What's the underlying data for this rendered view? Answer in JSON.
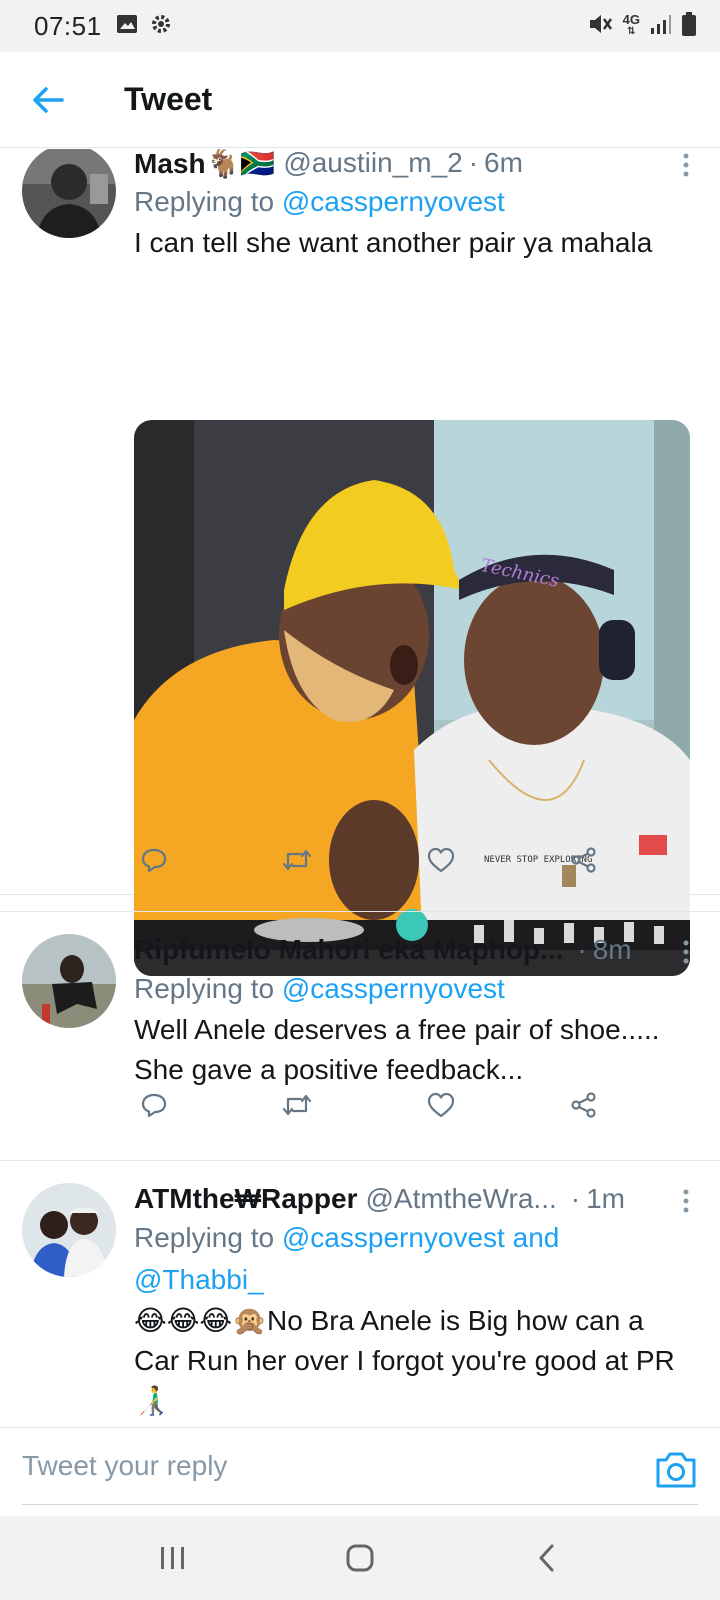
{
  "status_bar": {
    "time": "07:51",
    "left_icons": [
      "gallery-icon",
      "settings-icon"
    ],
    "right_icons": [
      "mute-icon",
      "network-4g-icon",
      "signal-icon",
      "battery-icon"
    ],
    "network_label": "4G"
  },
  "header": {
    "back_icon": "back-arrow-icon",
    "title": "Tweet"
  },
  "colors": {
    "accent": "#1da1f2",
    "text": "#14171a",
    "muted": "#657786",
    "divider": "#e1e8ed"
  },
  "tweets": [
    {
      "name": "Mash🐐🇿🇦",
      "handle": "@austiin_m_2",
      "time": "6m",
      "replying_prefix": "Replying to",
      "replying_to": "@casspernyovest",
      "text": "I can tell she want another pair ya mahala",
      "has_media": true,
      "media_text": [
        "Technics",
        "NEVER STOP EXPLORING"
      ]
    },
    {
      "name": "Ripfumelo Mahori eka Maphop...",
      "handle": "",
      "time": "8m",
      "replying_prefix": "Replying to",
      "replying_to": "@casspernyovest",
      "text": "Well Anele deserves a free pair of shoe..... She gave a positive feedback...",
      "has_media": false
    },
    {
      "name": "ATMthe₩Rapper",
      "handle": "@AtmtheWra...",
      "time": "1m",
      "replying_prefix": "Replying to",
      "replying_to": "@casspernyovest and @Thabbi_",
      "text": "😂😂😂🙊No Bra Anele is Big how can a Car Run her over I forgot you're good at PR👨‍🦯",
      "has_media": false
    }
  ],
  "actions": [
    "reply-icon",
    "retweet-icon",
    "like-icon",
    "share-icon"
  ],
  "reply_bar": {
    "placeholder": "Tweet your reply",
    "camera_icon": "camera-icon"
  },
  "nav_bar": [
    "recents-icon",
    "home-icon",
    "back-icon"
  ]
}
